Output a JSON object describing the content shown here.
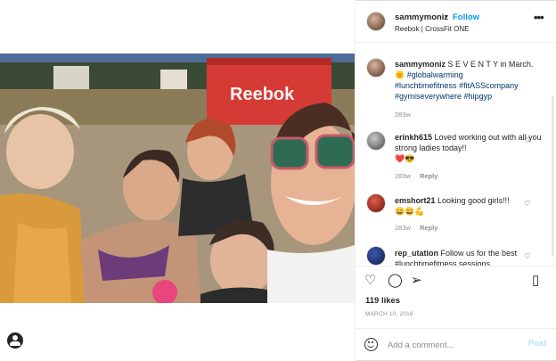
{
  "header": {
    "username": "sammymoniz",
    "separator": "•",
    "follow_label": "Follow",
    "subtitle": "Reebok | CrossFit ONE",
    "more_icon": "more-options-icon"
  },
  "caption": {
    "username": "sammymoniz",
    "text": "S E V E N T Y in March.",
    "emoji": "🌞",
    "hashtags": [
      "#globalwarming",
      "#lunchtimefitness",
      "#fitASScompany",
      "#gymiseverywhere",
      "#hipgyp"
    ],
    "age": "283w"
  },
  "comments": [
    {
      "username": "erinkh615",
      "text": "Loved working out with all you strong ladies today!!",
      "emoji": "❤️😎",
      "age": "283w",
      "reply_label": "Reply"
    },
    {
      "username": "emshort21",
      "text": "Looking good girls!!!",
      "emoji": "😀😀💪",
      "age": "283w",
      "reply_label": "Reply"
    },
    {
      "username": "rep_utation",
      "text": "Follow us for the best #lunchtimefitness sessions",
      "age": "",
      "reply_label": ""
    }
  ],
  "actions": {
    "like_icon": "heart-icon",
    "comment_icon": "comment-icon",
    "share_icon": "share-icon",
    "save_icon": "bookmark-icon",
    "likes": "119 likes",
    "date": "MARCH 10, 2016"
  },
  "add_comment": {
    "placeholder": "Add a comment...",
    "post_label": "Post"
  },
  "photo": {
    "sign_text": "Reebok"
  }
}
